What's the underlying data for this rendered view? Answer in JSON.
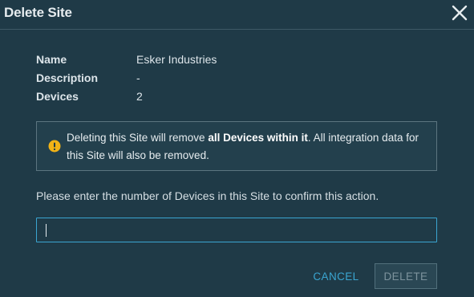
{
  "dialog": {
    "title": "Delete Site",
    "close_icon": "close-icon"
  },
  "details": [
    {
      "label": "Name",
      "value": "Esker Industries"
    },
    {
      "label": "Description",
      "value": "-"
    },
    {
      "label": "Devices",
      "value": "2"
    }
  ],
  "warning": {
    "icon": "warning-icon",
    "text_before": "Deleting this Site will remove ",
    "text_bold": "all Devices within it",
    "text_after": ". All integration data for this Site will also be removed."
  },
  "confirm": {
    "prompt": "Please enter the number of Devices in this Site to confirm this action.",
    "value": "",
    "placeholder": ""
  },
  "actions": {
    "cancel_label": "CANCEL",
    "delete_label": "DELETE",
    "delete_disabled": true
  },
  "colors": {
    "background": "#1f3a47",
    "accent": "#3aa5d1",
    "warning": "#f2b316"
  }
}
